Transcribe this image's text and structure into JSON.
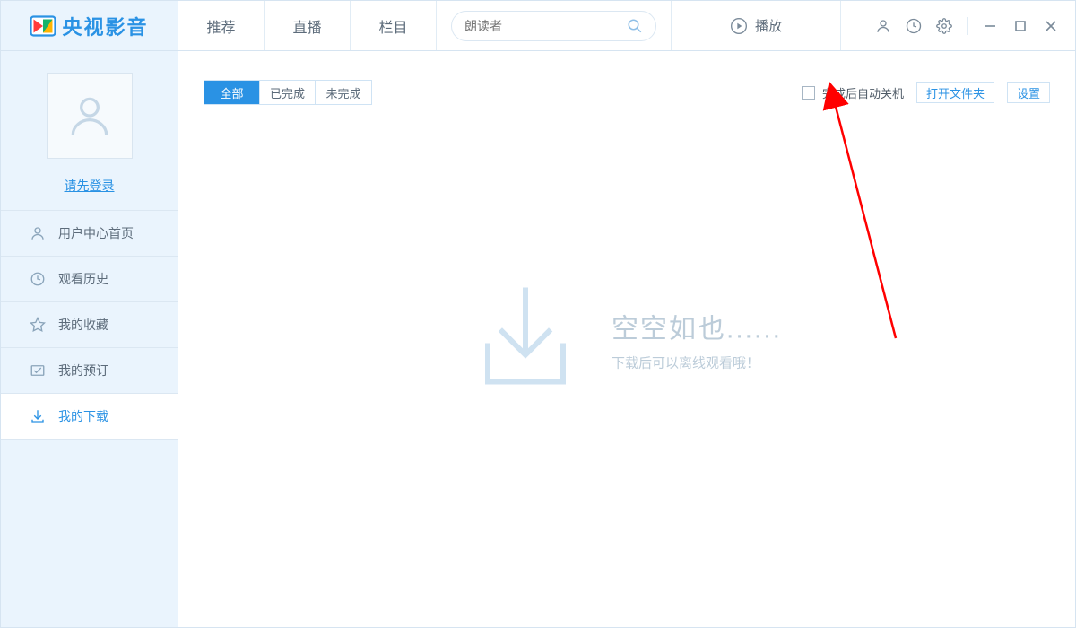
{
  "app": {
    "name_text": "央视影音"
  },
  "topnav": {
    "items": [
      "推荐",
      "直播",
      "栏目"
    ]
  },
  "search": {
    "placeholder": "朗读者"
  },
  "play_label": "播放",
  "sidebar": {
    "login_prompt": "请先登录",
    "items": [
      {
        "label": "用户中心首页"
      },
      {
        "label": "观看历史"
      },
      {
        "label": "我的收藏"
      },
      {
        "label": "我的预订"
      },
      {
        "label": "我的下载"
      }
    ],
    "active_index": 4
  },
  "main": {
    "filter_tabs": [
      "全部",
      "已完成",
      "未完成"
    ],
    "filter_active_index": 0,
    "auto_shutdown_label": "完成后自动关机",
    "open_folder_label": "打开文件夹",
    "settings_label": "设置",
    "empty": {
      "title": "空空如也......",
      "subtitle": "下载后可以离线观看哦！"
    }
  }
}
